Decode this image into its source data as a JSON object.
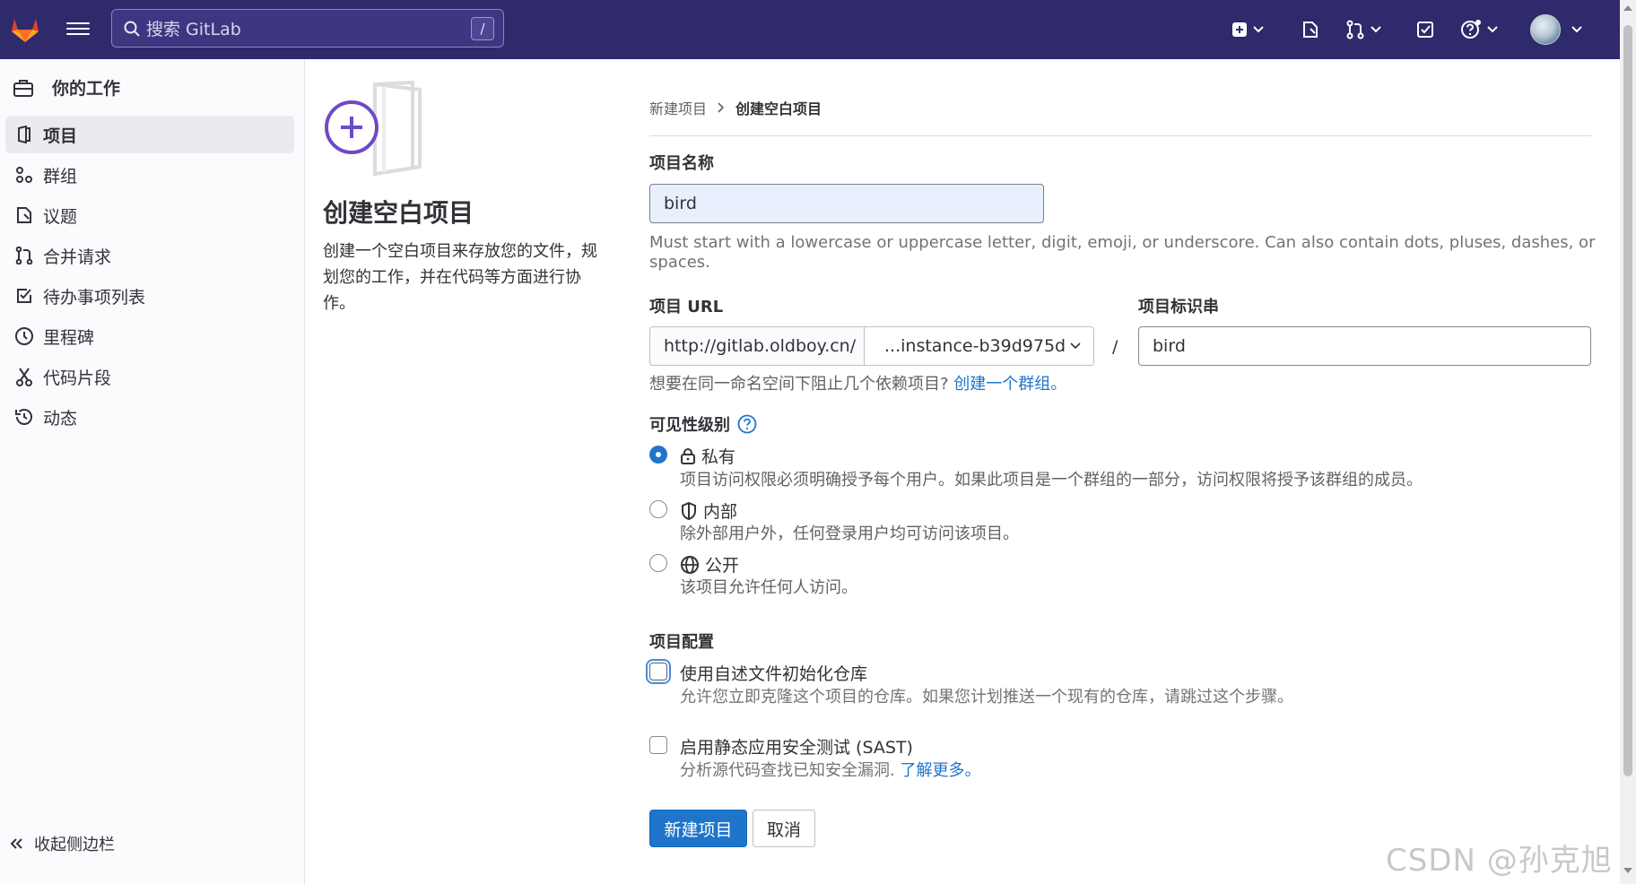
{
  "topbar": {
    "search_placeholder": "搜索 GitLab",
    "search_shortcut": "/",
    "icons": [
      "gitlab-logo-icon",
      "hamburger-icon",
      "create-new-icon",
      "issues-icon",
      "merge-requests-icon",
      "todos-icon",
      "help-icon",
      "avatar"
    ]
  },
  "sidebar": {
    "header": "你的工作",
    "items": [
      {
        "label": "项目",
        "icon": "project-icon",
        "active": true
      },
      {
        "label": "群组",
        "icon": "group-icon"
      },
      {
        "label": "议题",
        "icon": "issues-icon"
      },
      {
        "label": "合并请求",
        "icon": "merge-request-icon"
      },
      {
        "label": "待办事项列表",
        "icon": "todo-icon"
      },
      {
        "label": "里程碑",
        "icon": "milestone-icon"
      },
      {
        "label": "代码片段",
        "icon": "snippet-icon"
      },
      {
        "label": "动态",
        "icon": "activity-icon"
      }
    ],
    "collapse_label": "收起侧边栏"
  },
  "intro": {
    "title": "创建空白项目",
    "description": "创建一个空白项目来存放您的文件，规划您的工作，并在代码等方面进行协作。"
  },
  "breadcrumb": {
    "parent": "新建项目",
    "current": "创建空白项目"
  },
  "form": {
    "project_name_label": "项目名称",
    "project_name_value": "bird",
    "project_name_help": "Must start with a lowercase or uppercase letter, digit, emoji, or underscore. Can also contain dots, pluses, dashes, or spaces.",
    "project_url_label": "项目 URL",
    "url_prefix": "http://gitlab.oldboy.cn/",
    "namespace_value": "...instance-b39d975d",
    "url_separator": "/",
    "slug_label": "项目标识串",
    "slug_value": "bird",
    "group_help": "想要在同一命名空间下阻止几个依赖项目?",
    "group_link": "创建一个群组。",
    "visibility_label": "可见性级别",
    "visibility_options": [
      {
        "label": "私有",
        "icon": "lock-icon",
        "description": "项目访问权限必须明确授予每个用户。如果此项目是一个群组的一部分，访问权限将授予该群组的成员。",
        "checked": true
      },
      {
        "label": "内部",
        "icon": "shield-icon",
        "description": "除外部用户外，任何登录用户均可访问该项目。",
        "checked": false
      },
      {
        "label": "公开",
        "icon": "globe-icon",
        "description": "该项目允许任何人访问。",
        "checked": false
      }
    ],
    "config_label": "项目配置",
    "readme_label": "使用自述文件初始化仓库",
    "readme_help": "允许您立即克隆这个项目的仓库。如果您计划推送一个现有的仓库，请跳过这个步骤。",
    "sast_label": "启用静态应用安全测试 (SAST)",
    "sast_help": "分析源代码查找已知安全漏洞.",
    "sast_link": "了解更多。",
    "submit_label": "新建项目",
    "cancel_label": "取消"
  },
  "watermark": "CSDN @孙克旭",
  "colors": {
    "topbar": "#2f2a6b",
    "primary": "#1f75cb",
    "sidebar_bg": "#fbfafd",
    "active_item": "#ebeaf1"
  }
}
